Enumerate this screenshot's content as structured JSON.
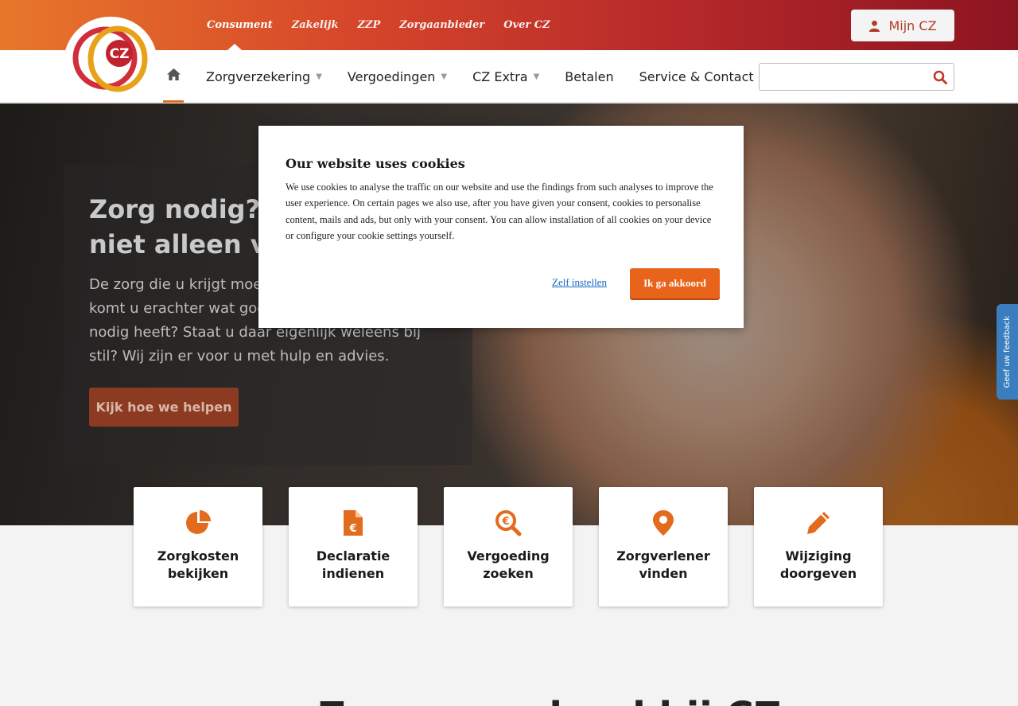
{
  "brand": {
    "logo_text": "CZ",
    "accent": "#e36b1e",
    "topbar_start": "#e8772a",
    "topbar_end": "#8c1421"
  },
  "toplinks": [
    "Consument",
    "Zakelijk",
    "ZZP",
    "Zorgaanbieder",
    "Over CZ"
  ],
  "mijncz": {
    "label": "Mijn CZ",
    "icon": "user-icon"
  },
  "nav": {
    "home_icon": "home-icon",
    "items": [
      {
        "label": "Zorgverzekering",
        "has_dropdown": true
      },
      {
        "label": "Vergoedingen",
        "has_dropdown": true
      },
      {
        "label": "CZ Extra",
        "has_dropdown": true
      },
      {
        "label": "Betalen",
        "has_dropdown": false
      },
      {
        "label": "Service & Contact",
        "has_dropdown": false
      }
    ],
    "search": {
      "value": "",
      "placeholder": "",
      "icon": "search-icon"
    }
  },
  "hero": {
    "title": "Zorg nodig? U staat er niet alleen voor",
    "text": "De zorg die u krijgt moet goed zijn. Maar hoe komt u erachter wat goede zorg is als u zorg nodig heeft? Staat u daar eigenlijk weleens bij stil? Wij zijn er voor u met hulp en advies.",
    "button": "Kijk hoe we helpen"
  },
  "tiles": [
    {
      "label": "Zorgkosten bekijken",
      "icon": "pie-chart-icon"
    },
    {
      "label": "Declaratie indienen",
      "icon": "euro-document-icon"
    },
    {
      "label": "Vergoeding zoeken",
      "icon": "euro-search-icon"
    },
    {
      "label": "Zorgverlener vinden",
      "icon": "map-pin-icon"
    },
    {
      "label": "Wijziging doorgeven",
      "icon": "pencil-icon"
    }
  ],
  "bottom_title": "Zorg verzekerd bij CZ",
  "feedback": {
    "label": "Geef uw feedback"
  },
  "cookie": {
    "title": "Our website uses cookies",
    "text": "We use cookies to analyse the traffic on our website and use the findings from such analyses to improve the user experience. On certain pages we also use, after you have given your consent, cookies to personalise content, mails and ads, but only with your consent. You can allow installation of all cookies on your device or configure your cookie settings yourself.",
    "configure": "Zelf instellen",
    "accept": "Ik ga akkoord"
  }
}
